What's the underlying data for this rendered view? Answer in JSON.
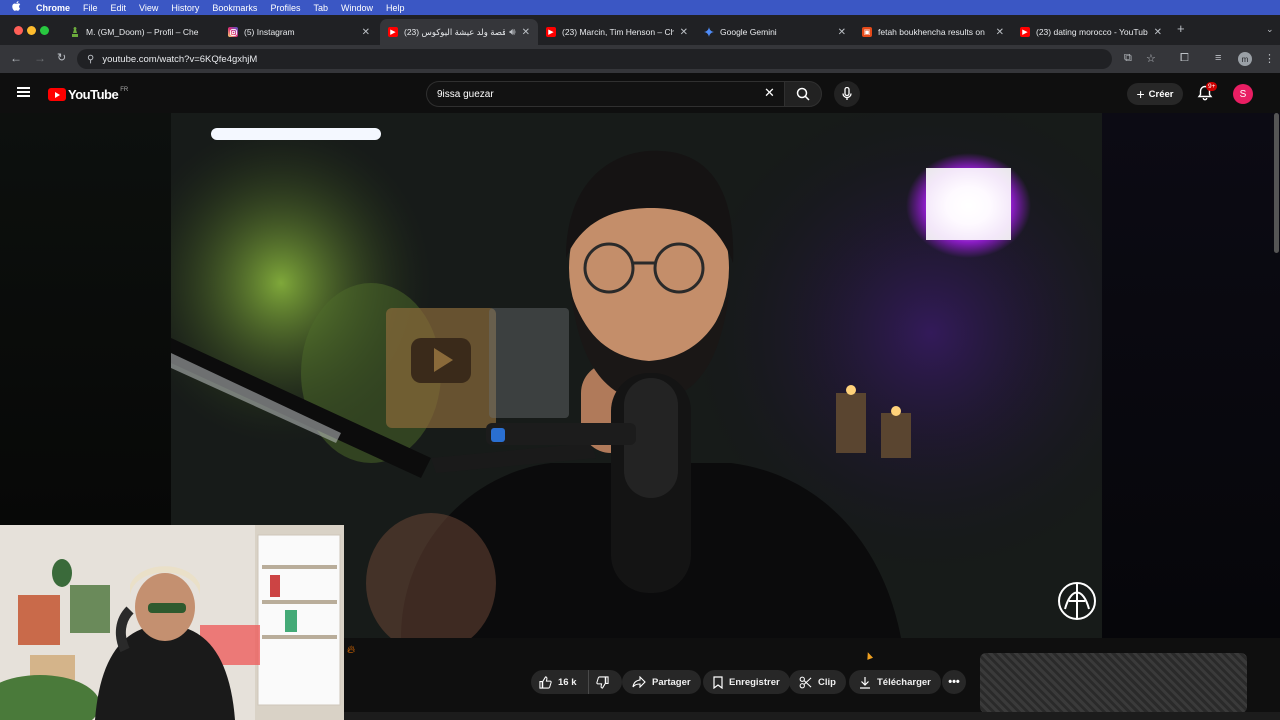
{
  "mac_menu": {
    "app": "Chrome",
    "items": [
      "File",
      "Edit",
      "View",
      "History",
      "Bookmarks",
      "Profiles",
      "Tab",
      "Window",
      "Help"
    ]
  },
  "tabs": [
    {
      "title": "M. (GM_Doom) – Profil – Che",
      "icon": "chess-icon",
      "color": "#6cab3c",
      "active": false
    },
    {
      "title": "(5) Instagram",
      "icon": "instagram-icon",
      "color": "#d62976",
      "active": false
    },
    {
      "title": "(23) قصة ولد عيشة اليوكوس",
      "icon": "youtube-icon",
      "color": "#ff0000",
      "active": true
    },
    {
      "title": "(23) Marcin, Tim Henson – Ch",
      "icon": "youtube-icon",
      "color": "#ff0000",
      "active": false
    },
    {
      "title": "Google Gemini",
      "icon": "gemini-icon",
      "color": "#4f8cf7",
      "active": false
    },
    {
      "title": "fetah boukhencha results on",
      "icon": "bookmark-icon",
      "color": "#e64a19",
      "active": false
    },
    {
      "title": "(23) dating morocco - YouTub",
      "icon": "youtube-icon",
      "color": "#ff0000",
      "active": false
    }
  ],
  "address_bar": {
    "url": "youtube.com/watch?v=6KQfe4gxhjM"
  },
  "profile_initial": "m",
  "youtube": {
    "logo_text": "YouTube",
    "country_code": "FR",
    "search_value": "9issa guezar",
    "create_label": "Créer",
    "notifications_badge": "9+",
    "avatar_initial": "S"
  },
  "actions": {
    "like_count": "16 k",
    "share_label": "Partager",
    "save_label": "Enregistrer",
    "clip_label": "Clip",
    "download_label": "Télécharger"
  },
  "colors": {
    "yt_red": "#ff0000",
    "mac_menu_blue": "#3b57c4",
    "avatar_pink": "#e91e63"
  }
}
